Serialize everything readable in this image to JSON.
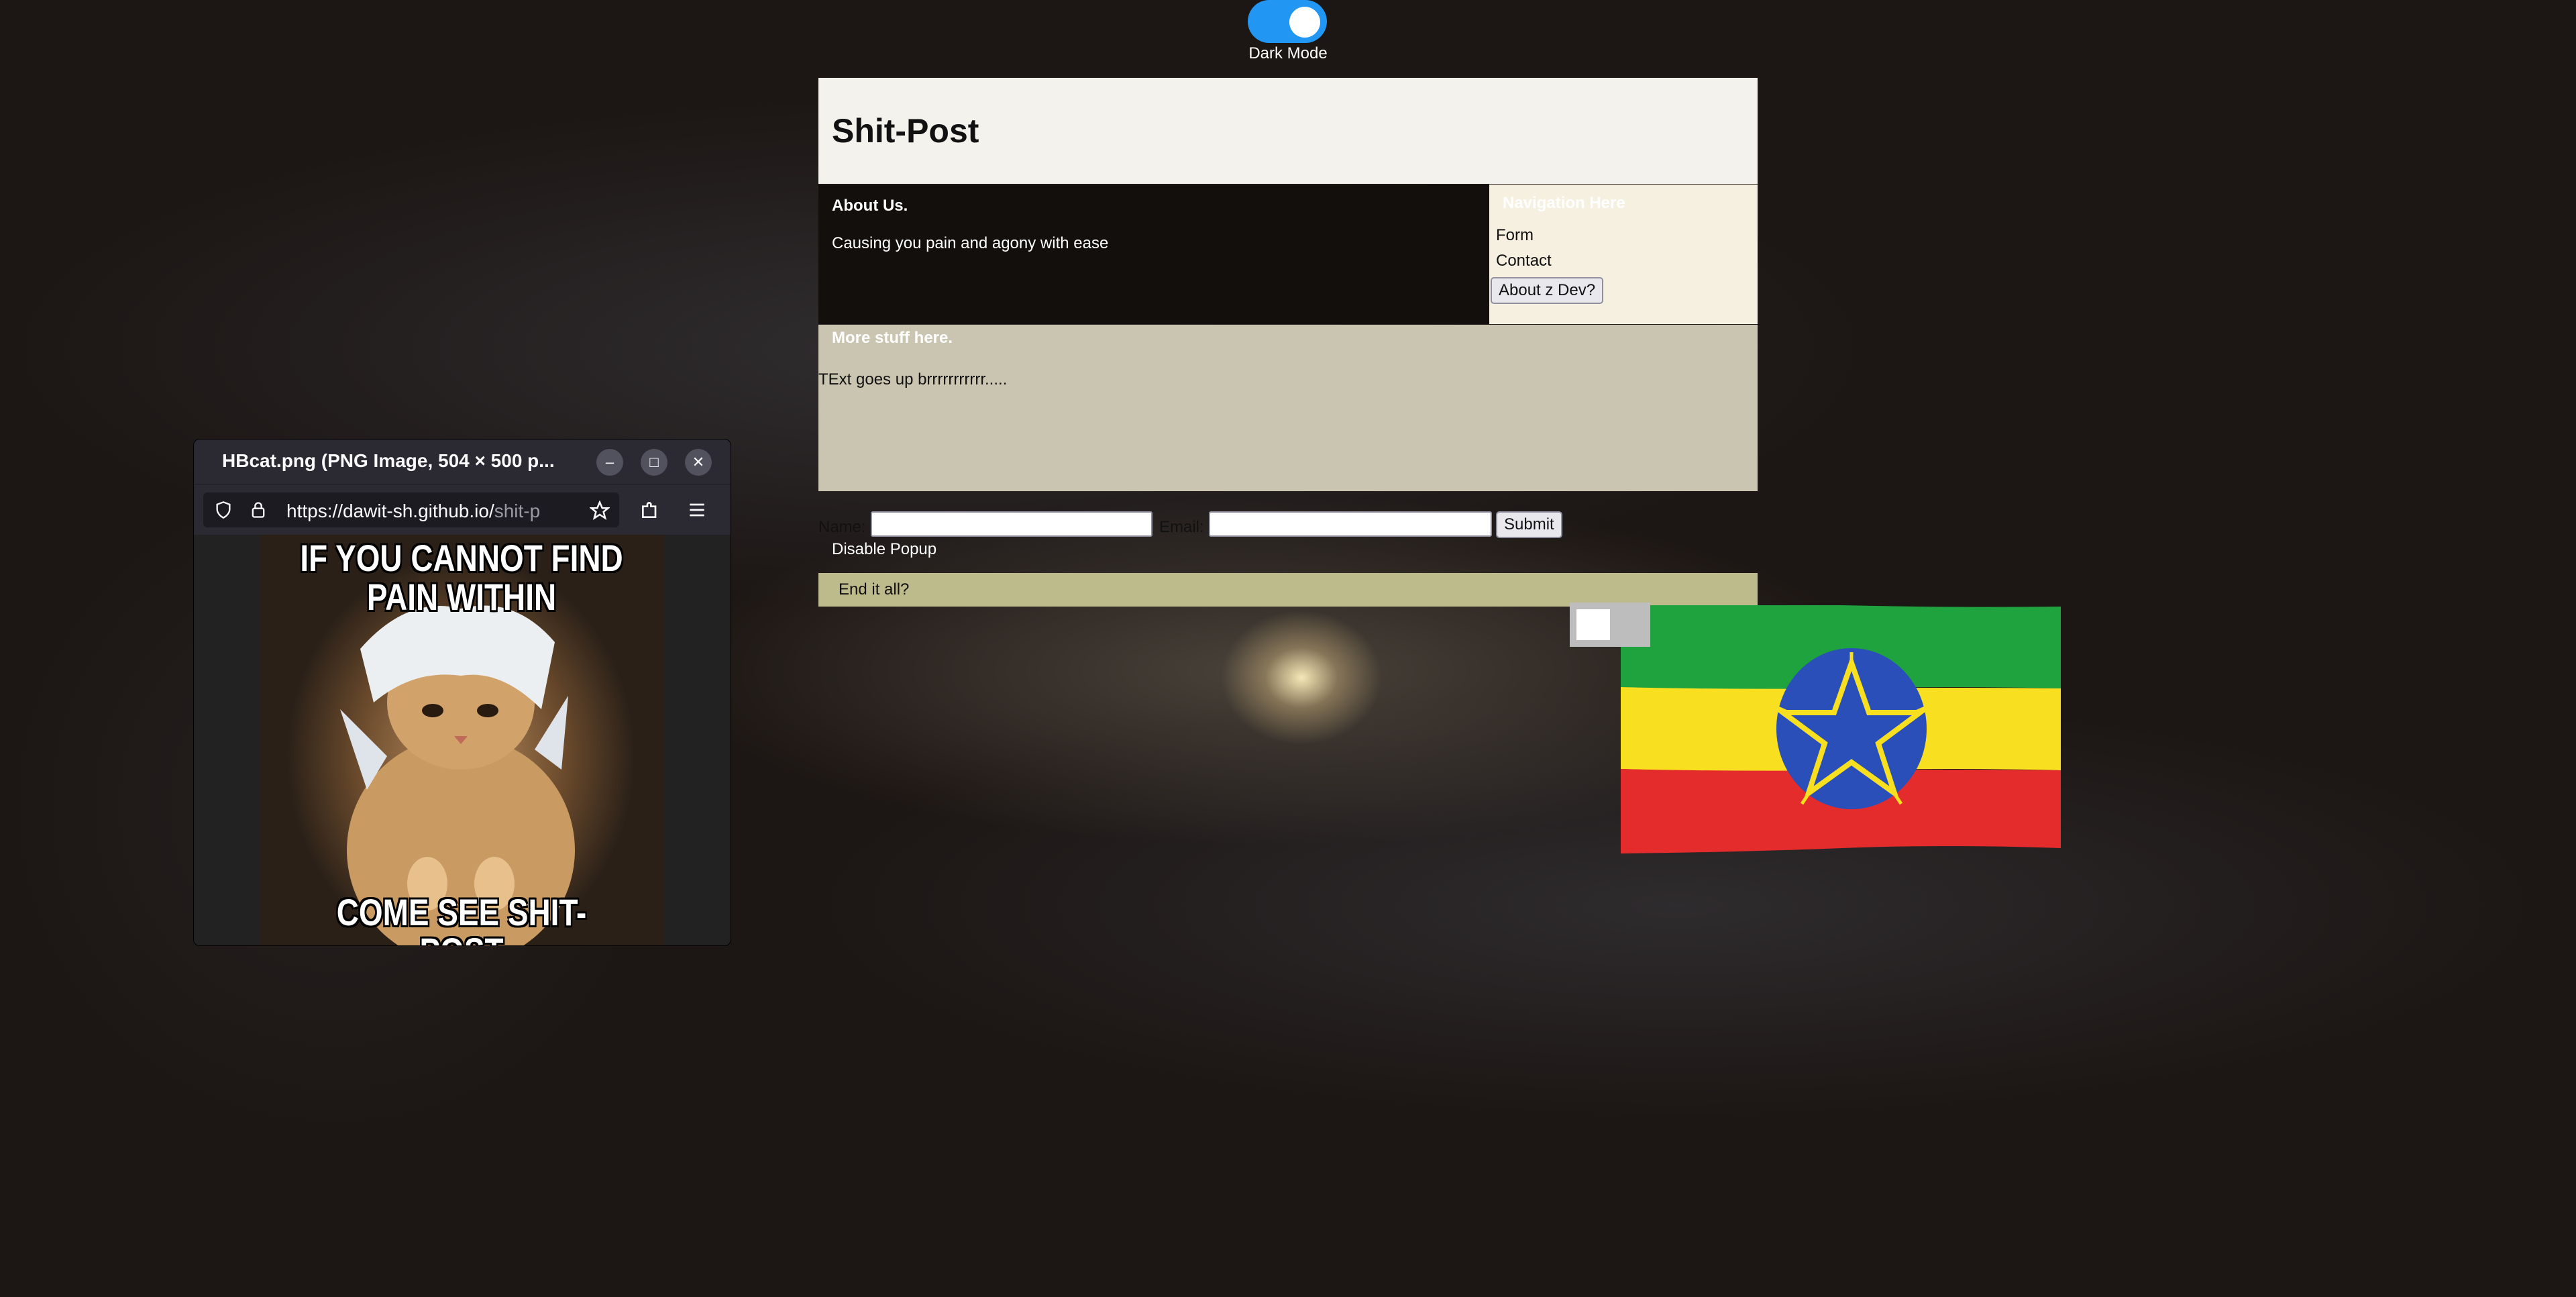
{
  "dark_mode": {
    "label": "Dark Mode",
    "enabled": true
  },
  "header": {
    "title": "Shit-Post"
  },
  "about": {
    "title": "About Us.",
    "text": "Causing you pain and agony with ease"
  },
  "nav": {
    "title": "Navigation Here",
    "links": [
      "Form",
      "Contact"
    ],
    "button_label": "About z Dev?"
  },
  "more": {
    "title": "More stuff here.",
    "text": "TExt goes up brrrrrrrrrrr....."
  },
  "form": {
    "name_label": "Name:",
    "email_label": "Email:",
    "submit_label": "Submit",
    "name_value": "",
    "email_value": ""
  },
  "disable_popup_label": "Disable Popup",
  "end_label": "End it all?",
  "colors": {
    "toggle_accent": "#2196f3",
    "flag_green": "#1fa33f",
    "flag_yellow": "#f8e020",
    "flag_red": "#e42c2c",
    "flag_emblem_blue": "#2a4fb8"
  },
  "popup": {
    "window_title": "HBcat.png (PNG Image, 504 × 500 p...",
    "url_host": "https://dawit-sh.github.io/",
    "url_path": "shit-p",
    "meme_top": "IF YOU CANNOT FIND PAIN WITHIN",
    "meme_bottom": "COME SEE SHIT-POST",
    "icons": [
      "minimize-icon",
      "maximize-icon",
      "close-icon",
      "shield-icon",
      "lock-icon",
      "star-icon",
      "extensions-icon",
      "menu-icon"
    ]
  }
}
